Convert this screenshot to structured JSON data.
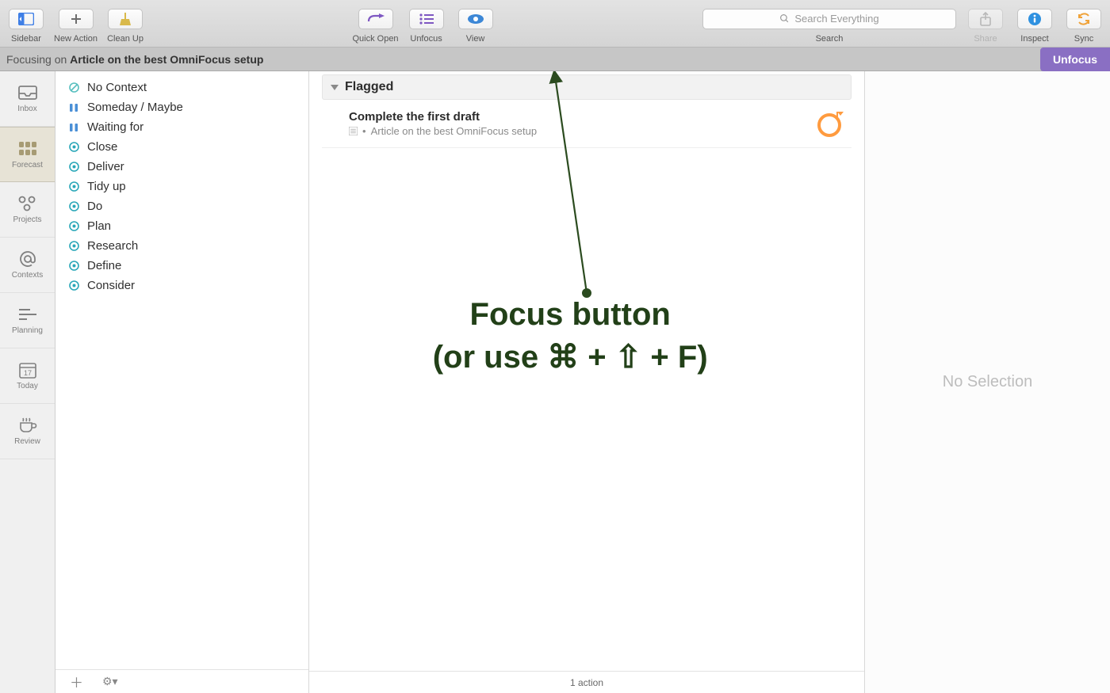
{
  "toolbar": {
    "left": [
      {
        "id": "sidebar",
        "label": "Sidebar",
        "icon": "sidebar-icon",
        "color": "#3f7fe6"
      },
      {
        "id": "newaction",
        "label": "New Action",
        "icon": "plus-icon",
        "color": "#6d6d6d"
      },
      {
        "id": "cleanup",
        "label": "Clean Up",
        "icon": "broom-icon",
        "color": "#d9b94a"
      }
    ],
    "center": [
      {
        "id": "quickopen",
        "label": "Quick Open",
        "icon": "arrow-return-icon",
        "color": "#7e57c2"
      },
      {
        "id": "unfocus",
        "label": "Unfocus",
        "icon": "list-icon",
        "color": "#7e57c2"
      },
      {
        "id": "view",
        "label": "View",
        "icon": "eye-icon",
        "color": "#3c87d6"
      }
    ],
    "right": [
      {
        "id": "share",
        "label": "Share",
        "icon": "share-icon",
        "disabled": true,
        "color": "#9a9a9a"
      },
      {
        "id": "inspect",
        "label": "Inspect",
        "icon": "info-icon",
        "color": "#2f91e0"
      },
      {
        "id": "sync",
        "label": "Sync",
        "icon": "sync-icon",
        "color": "#f0a33a"
      }
    ],
    "search": {
      "placeholder": "Search Everything",
      "label": "Search"
    }
  },
  "focusbar": {
    "prefix": "Focusing on ",
    "title": "Article on the best OmniFocus setup",
    "button": "Unfocus"
  },
  "leftnav": [
    {
      "id": "inbox",
      "label": "Inbox",
      "icon": "inbox-icon"
    },
    {
      "id": "forecast",
      "label": "Forecast",
      "icon": "grid-icon",
      "active": true
    },
    {
      "id": "projects",
      "label": "Projects",
      "icon": "projects-icon"
    },
    {
      "id": "contexts",
      "label": "Contexts",
      "icon": "at-icon"
    },
    {
      "id": "planning",
      "label": "Planning",
      "icon": "planning-icon"
    },
    {
      "id": "today",
      "label": "Today",
      "icon": "calendar-icon",
      "badge": "17"
    },
    {
      "id": "review",
      "label": "Review",
      "icon": "cup-icon"
    }
  ],
  "contexts": [
    {
      "label": "No Context",
      "icon": "nocontext",
      "color": "#58bfbf"
    },
    {
      "label": "Someday / Maybe",
      "icon": "pause",
      "color": "#4a8fd6"
    },
    {
      "label": "Waiting for",
      "icon": "pause",
      "color": "#4a8fd6"
    },
    {
      "label": "Close",
      "icon": "target",
      "color": "#2aa7b8"
    },
    {
      "label": "Deliver",
      "icon": "target",
      "color": "#2aa7b8"
    },
    {
      "label": "Tidy up",
      "icon": "target",
      "color": "#2aa7b8"
    },
    {
      "label": "Do",
      "icon": "target",
      "color": "#2aa7b8"
    },
    {
      "label": "Plan",
      "icon": "target",
      "color": "#2aa7b8"
    },
    {
      "label": "Research",
      "icon": "target",
      "color": "#2aa7b8"
    },
    {
      "label": "Define",
      "icon": "target",
      "color": "#2aa7b8"
    },
    {
      "label": "Consider",
      "icon": "target",
      "color": "#2aa7b8"
    }
  ],
  "main": {
    "group_title": "Flagged",
    "task": {
      "title": "Complete the first draft",
      "project": "Article on the best OmniFocus setup"
    },
    "status": "1 action"
  },
  "inspector": {
    "placeholder": "No Selection"
  },
  "annotation": {
    "line1": "Focus button",
    "line2": "(or use ⌘ + ⇧ + F)"
  }
}
